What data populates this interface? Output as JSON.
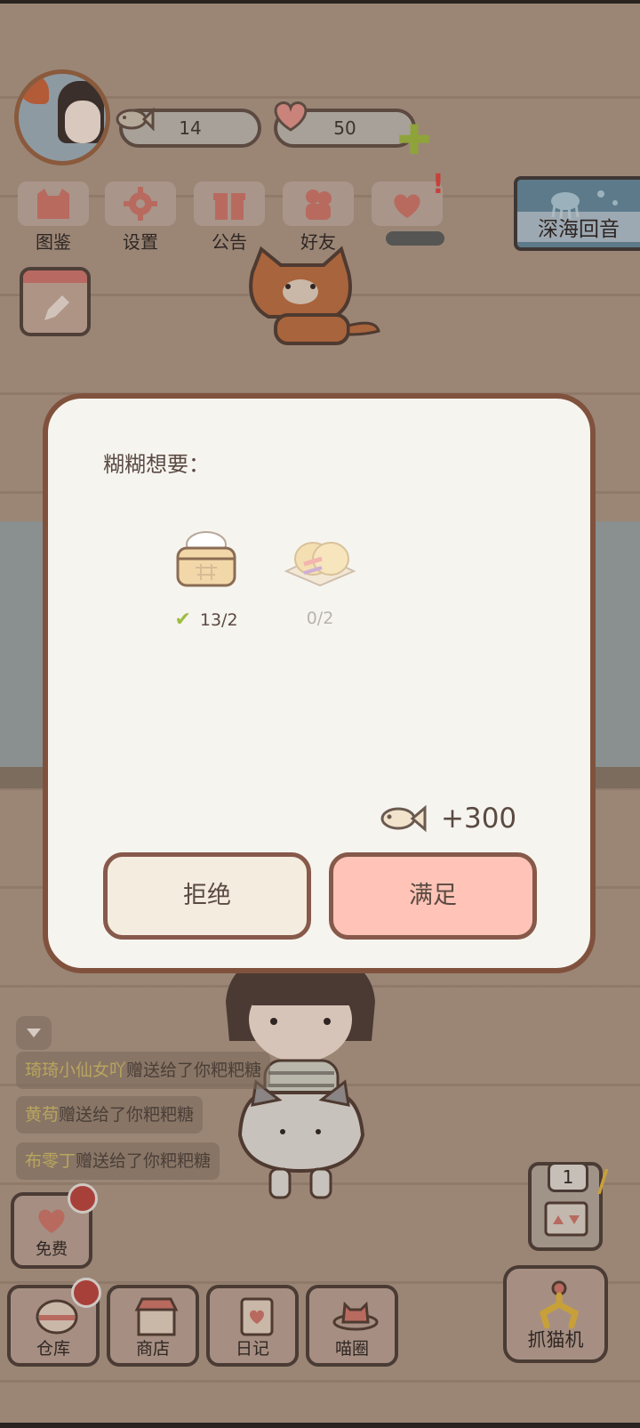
{
  "hud": {
    "fish_count": "14",
    "heart_count": "50"
  },
  "menu": [
    {
      "label": "图鉴",
      "icon": "cat-book-icon"
    },
    {
      "label": "设置",
      "icon": "gear-icon"
    },
    {
      "label": "公告",
      "icon": "gift-icon"
    },
    {
      "label": "好友",
      "icon": "friends-icon"
    },
    {
      "label": "",
      "icon": "heart-hands-icon"
    }
  ],
  "event_banner": {
    "label": "深海回音"
  },
  "dialog": {
    "title": "糊糊想要：",
    "items": [
      {
        "name": "steamed-bun-basket",
        "count": "13/2",
        "done": true
      },
      {
        "name": "sandwich",
        "count": "0/2",
        "done": false
      }
    ],
    "reward": "+300",
    "reject_label": "拒绝",
    "accept_label": "满足"
  },
  "messages": [
    {
      "name": "琦琦小仙女吖",
      "text": "赠送给了你粑粑糖"
    },
    {
      "name": "黄苟",
      "text": "赠送给了你粑粑糖"
    },
    {
      "name": "布零丁",
      "text": "赠送给了你粑粑糖"
    }
  ],
  "free_button": {
    "label": "免费"
  },
  "dock": [
    {
      "label": "仓库"
    },
    {
      "label": "商店"
    },
    {
      "label": "日记"
    },
    {
      "label": "喵圈"
    }
  ],
  "claw": {
    "count": "1",
    "label": "抓猫机"
  },
  "colors": {
    "accept": "#ffc4b7",
    "reject": "#f4ecdf",
    "border": "#86594a",
    "check": "#9cbd3f"
  }
}
